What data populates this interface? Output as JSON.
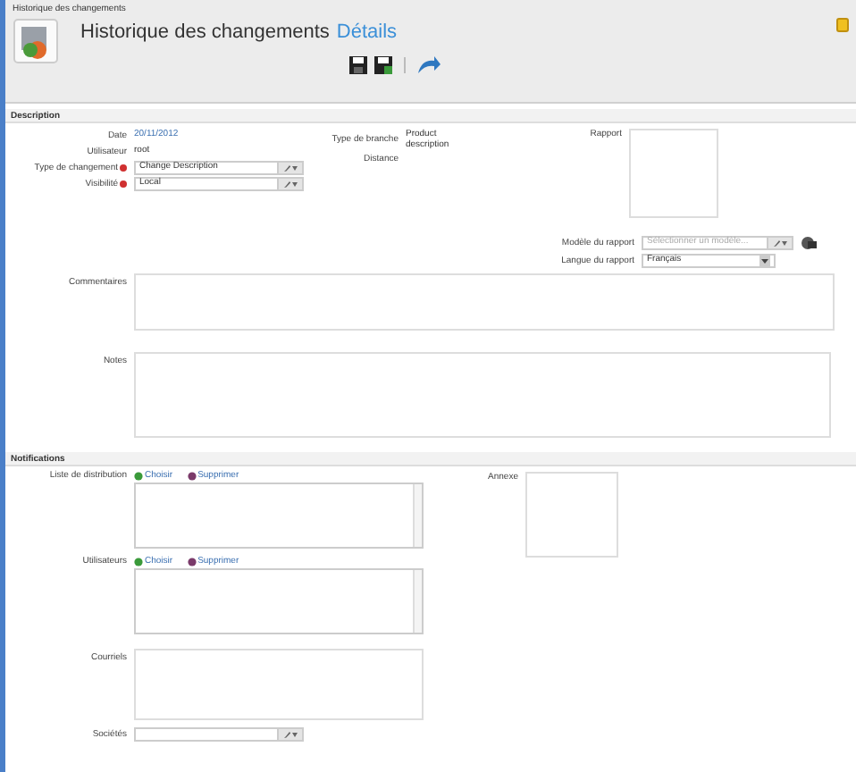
{
  "window": {
    "title": "Historique des changements"
  },
  "header": {
    "title": "Historique des changements",
    "subtitle": "Détails"
  },
  "toolbar": [
    {
      "kind": "save"
    },
    {
      "kind": "save-close"
    },
    {
      "kind": "back"
    }
  ],
  "description": {
    "heading": "Description",
    "left": [
      {
        "label": "Date",
        "value": "20/11/2012",
        "kind": "link"
      },
      {
        "label": "Utilisateur",
        "value": "root",
        "kind": "text"
      },
      {
        "label": "Type de changement",
        "value": "Change Description",
        "kind": "lookup",
        "required": true
      },
      {
        "label": "Visibilité",
        "value": "Local",
        "kind": "lookup",
        "required": true
      }
    ],
    "middle": [
      {
        "label": "Type de branche",
        "value": "Product description"
      },
      {
        "label": "Distance"
      }
    ],
    "report": {
      "label": "Rapport"
    },
    "template": {
      "label": "Modèle du rapport",
      "placeholder": "Sélectionner un modèle..."
    },
    "language": {
      "label": "Langue du rapport",
      "value": "Français"
    },
    "comments": {
      "label": "Commentaires"
    },
    "notes": {
      "label": "Notes"
    }
  },
  "notifications": {
    "heading": "Notifications",
    "lists": [
      {
        "label": "Liste de distribution",
        "actions": [
          "Choisir",
          "Supprimer"
        ]
      },
      {
        "label": "Utilisateurs",
        "actions": [
          "Choisir",
          "Supprimer"
        ]
      }
    ],
    "attachment": {
      "label": "Annexe"
    },
    "emails": {
      "label": "Courriels"
    },
    "companies": {
      "label": "Sociétés"
    }
  }
}
